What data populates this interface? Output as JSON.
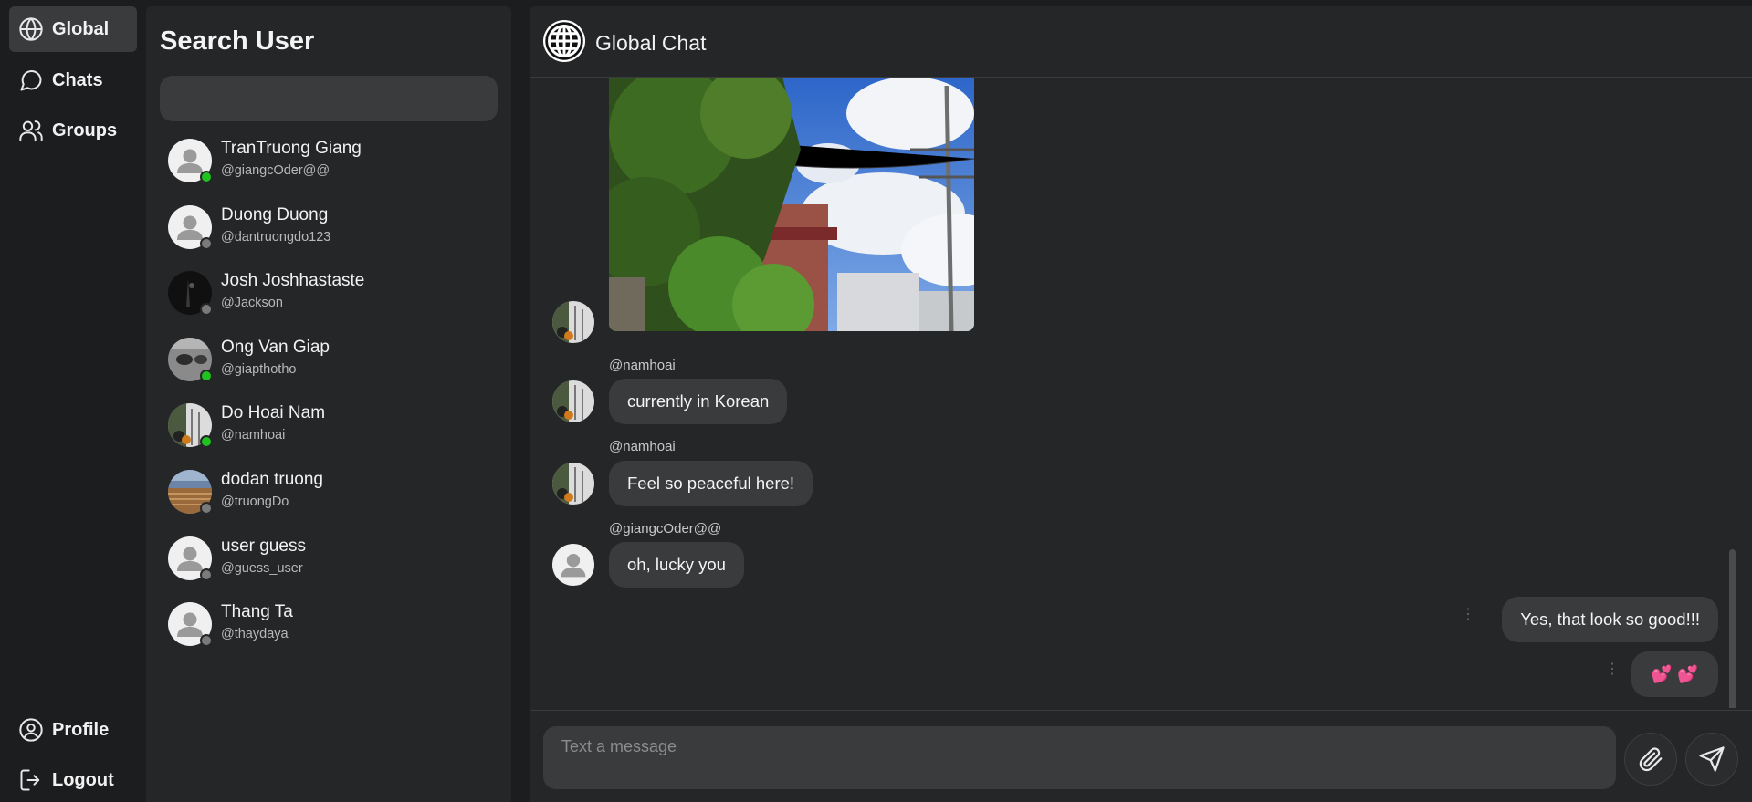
{
  "nav": {
    "items": [
      {
        "label": "Global",
        "icon": "globe-icon"
      },
      {
        "label": "Chats",
        "icon": "chat-bubble-icon"
      },
      {
        "label": "Groups",
        "icon": "users-icon"
      }
    ],
    "bottom": [
      {
        "label": "Profile",
        "icon": "user-circle-icon"
      },
      {
        "label": "Logout",
        "icon": "logout-icon"
      }
    ]
  },
  "search": {
    "title": "Search User",
    "value": "",
    "placeholder": ""
  },
  "users": [
    {
      "name": "TranTruong Giang",
      "handle": "@giangcOder@@",
      "status": "online"
    },
    {
      "name": "Duong Duong",
      "handle": "@dantruongdo123",
      "status": "offline"
    },
    {
      "name": "Josh Joshhastaste",
      "handle": "@Jackson",
      "status": "offline"
    },
    {
      "name": "Ong Van Giap",
      "handle": "@giapthotho",
      "status": "online"
    },
    {
      "name": "Do Hoai Nam",
      "handle": "@namhoai",
      "status": "online"
    },
    {
      "name": "dodan truong",
      "handle": "@truongDo",
      "status": "offline"
    },
    {
      "name": "user guess",
      "handle": "@guess_user",
      "status": "offline"
    },
    {
      "name": "Thang Ta",
      "handle": "@thaydaya",
      "status": "offline"
    }
  ],
  "chat": {
    "title": "Global Chat",
    "header_icon": "globe-icon",
    "messages": [
      {
        "sender": "",
        "type": "image",
        "image": "street-photo"
      },
      {
        "sender": "@namhoai",
        "text": "currently in Korean"
      },
      {
        "sender": "@namhoai",
        "text": "Feel so peaceful here!"
      },
      {
        "sender": "@giangcOder@@",
        "text": "oh, lucky you"
      }
    ],
    "my_messages": [
      {
        "text": "Yes, that look so good!!!",
        "menu": "⋮"
      },
      {
        "text": "💕 💕",
        "menu": "⋮"
      }
    ]
  },
  "composer": {
    "placeholder": "Text a message",
    "value": "",
    "attach_icon": "paperclip-icon",
    "send_icon": "send-icon"
  },
  "colors": {
    "background": "#1c1d1f",
    "panel": "#252628",
    "bubble": "#3a3b3d",
    "online": "#1fc21f",
    "offline": "#7a7a7a"
  }
}
